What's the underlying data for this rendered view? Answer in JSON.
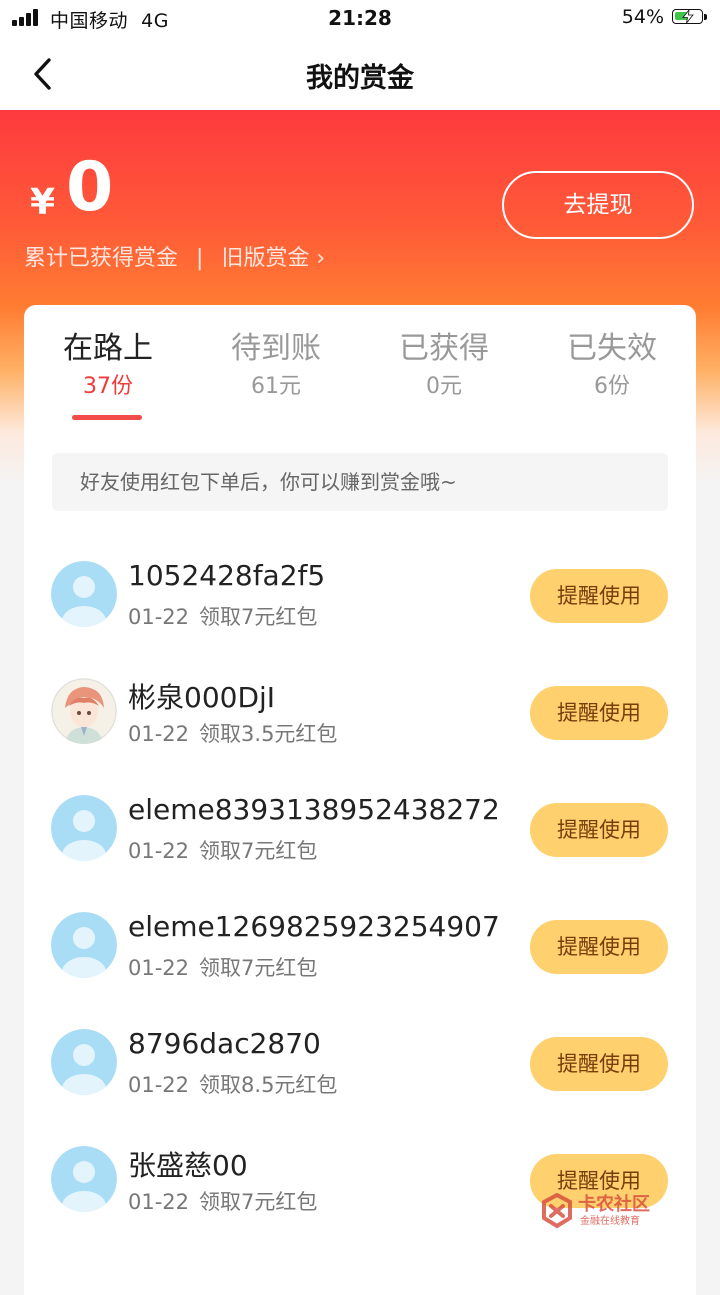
{
  "status_bar": {
    "carrier": "中国移动",
    "network": "4G",
    "time": "21:28",
    "battery": "54%",
    "battery_level": 0.54,
    "battery_color": "#3fc548"
  },
  "nav": {
    "back_icon": "chevron-left-icon",
    "title": "我的赏金"
  },
  "header": {
    "currency": "¥",
    "amount": "0",
    "amount_label": "累计已获得赏金",
    "separator": "|",
    "old_link": "旧版赏金 ›",
    "withdraw_button": "去提现",
    "colors": {
      "gradient_top": "#fe3a3e",
      "gradient_mid": "#ff7d32"
    }
  },
  "tabs": [
    {
      "label": "在路上",
      "sub": "37份",
      "active": true
    },
    {
      "label": "待到账",
      "sub": "61元",
      "active": false
    },
    {
      "label": "已获得",
      "sub": "0元",
      "active": false
    },
    {
      "label": "已失效",
      "sub": "6份",
      "active": false
    }
  ],
  "tip": "好友使用红包下单后，你可以赚到赏金哦~",
  "rows": [
    {
      "name": "1052428fa2f5",
      "date": "01-22",
      "detail": "领取7元红包",
      "button": "提醒使用",
      "avatar": "default-avatar-icon"
    },
    {
      "name": "彬泉000DjI",
      "date": "01-22",
      "detail": "领取3.5元红包",
      "button": "提醒使用",
      "avatar": "anime-avatar-icon"
    },
    {
      "name": "eleme8393138952438272",
      "date": "01-22",
      "detail": "领取7元红包",
      "button": "提醒使用",
      "avatar": "default-avatar-icon"
    },
    {
      "name": "eleme1269825923254907",
      "date": "01-22",
      "detail": "领取7元红包",
      "button": "提醒使用",
      "avatar": "default-avatar-icon"
    },
    {
      "name": "8796dac2870",
      "date": "01-22",
      "detail": "领取8.5元红包",
      "button": "提醒使用",
      "avatar": "default-avatar-icon"
    },
    {
      "name": "张盛慈00",
      "date": "01-22",
      "detail": "领取7元红包",
      "button": "提醒使用",
      "avatar": "default-avatar-icon"
    }
  ],
  "watermark": {
    "title": "卡农社区",
    "subtitle": "金融在线教育"
  },
  "colors": {
    "accent_red": "#ef3b3a",
    "button_yellow": "#fed16e",
    "button_text": "#773e0c"
  }
}
